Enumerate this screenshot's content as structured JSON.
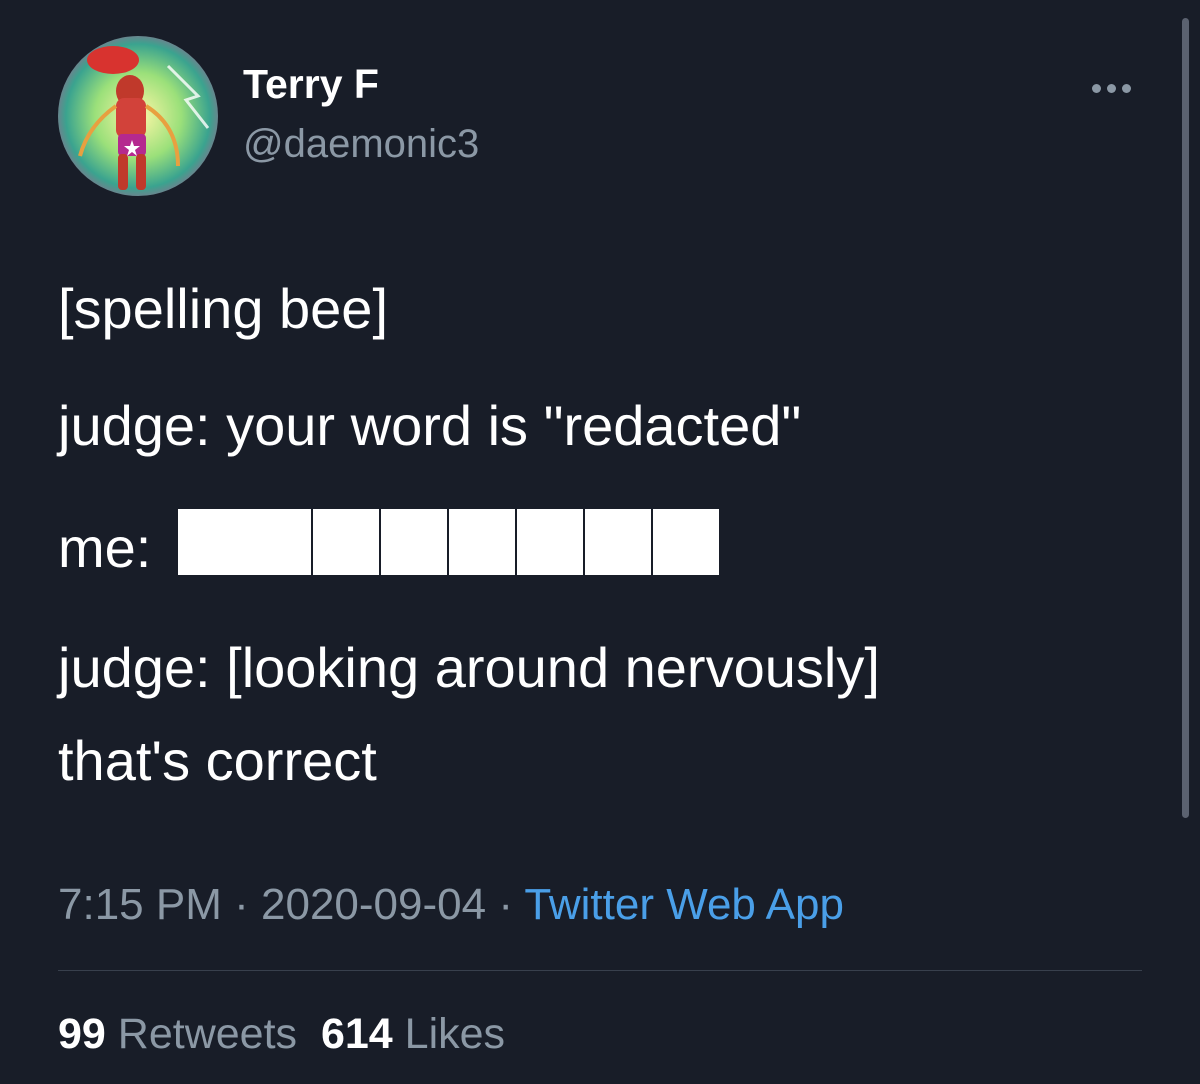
{
  "author": {
    "display_name": "Terry F",
    "handle": "@daemonic3"
  },
  "tweet": {
    "lines": [
      "[spelling bee]",
      "judge: your word is \"redacted\"",
      "me:",
      "judge: [looking around nervously]",
      "that's correct"
    ],
    "redacted_block_count": 7
  },
  "meta": {
    "time": "7:15 PM",
    "separator": "·",
    "date": "2020-09-04",
    "source": "Twitter Web App"
  },
  "stats": {
    "retweets_count": "99",
    "retweets_label": "Retweets",
    "likes_count": "614",
    "likes_label": "Likes"
  },
  "icons": {
    "more": "more-horizontal-icon"
  },
  "colors": {
    "background": "#181d28",
    "text_primary": "#ffffff",
    "text_secondary": "#8b98a5",
    "link": "#4a9fe8"
  }
}
